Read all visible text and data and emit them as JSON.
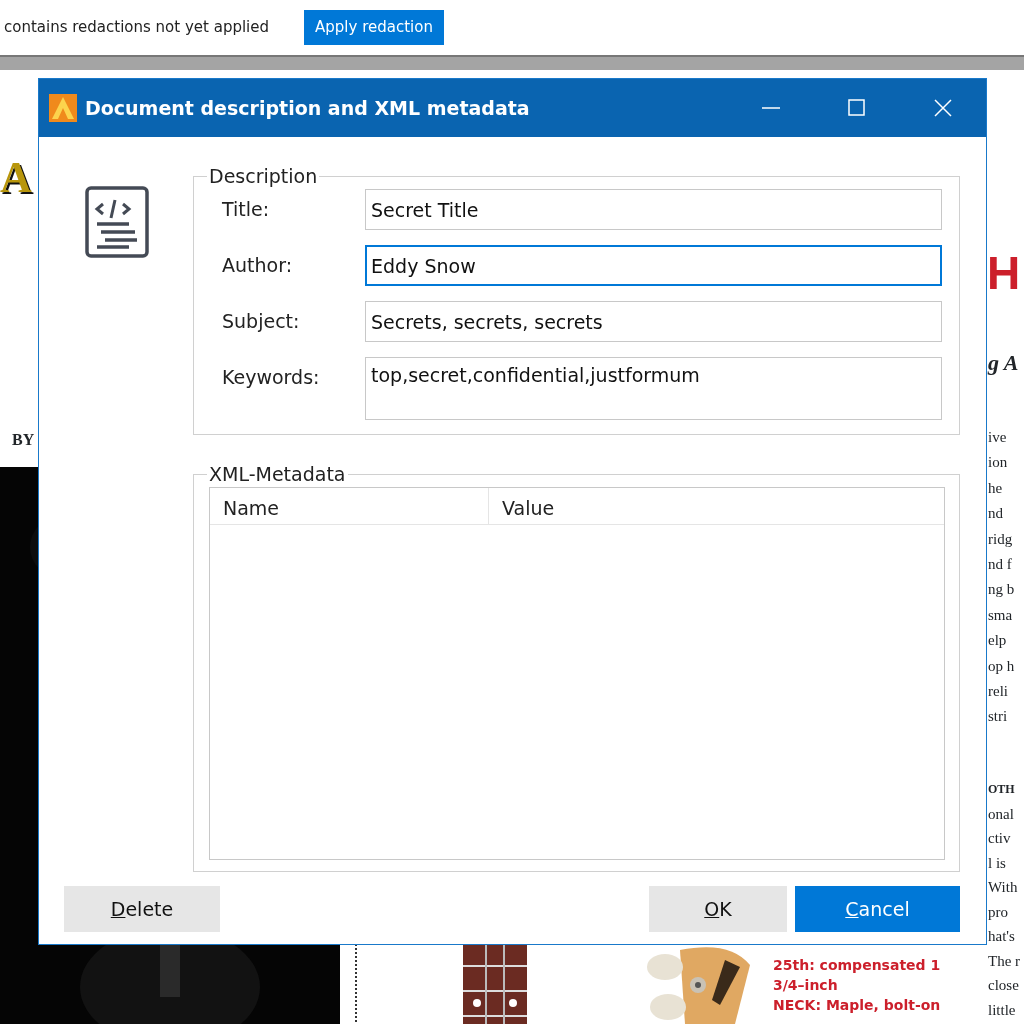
{
  "toolbar": {
    "message": "contains redactions not yet applied",
    "button": "Apply redaction"
  },
  "background_page": {
    "headline": "A",
    "byline": "BY",
    "red_heading": "H",
    "subheading": "g A",
    "column_lines": [
      "ive",
      "ion",
      "he",
      "nd",
      "ridg",
      "nd f",
      "ng b",
      "sma",
      "elp",
      "op h",
      "reli",
      "stri"
    ],
    "column_heading": "OTH",
    "column_lines_2": [
      "onal",
      "ctiv",
      "l is",
      "With",
      "pro",
      "hat's",
      "The r",
      "close",
      "little"
    ],
    "spec_lines": [
      "25th: compensated 1",
      "3/4–inch",
      "**NECK:** Maple, bolt-on"
    ],
    "pictures": [
      {
        "kind": "picture"
      },
      {
        "kind": "picture"
      },
      {
        "kind": "picture"
      }
    ]
  },
  "dialog": {
    "title": "Document description and XML metadata",
    "description": {
      "legend": "Description",
      "fields": [
        {
          "label": "Title:",
          "value": "Secret Title",
          "focused": false,
          "kind": "single"
        },
        {
          "label": "Author:",
          "value": "Eddy Snow",
          "focused": true,
          "kind": "single"
        },
        {
          "label": "Subject:",
          "value": "Secrets, secrets, secrets",
          "focused": false,
          "kind": "single"
        },
        {
          "label": "Keywords:",
          "value": "top,secret,confidential,justformum",
          "focused": false,
          "kind": "multiline"
        }
      ]
    },
    "xml_metadata": {
      "legend": "XML-Metadata",
      "columns": [
        "Name",
        "Value"
      ]
    },
    "buttons": [
      {
        "label": "Delete",
        "primary": false
      },
      {
        "label": "OK",
        "primary": false
      },
      {
        "label": "Cancel",
        "primary": true
      }
    ]
  }
}
